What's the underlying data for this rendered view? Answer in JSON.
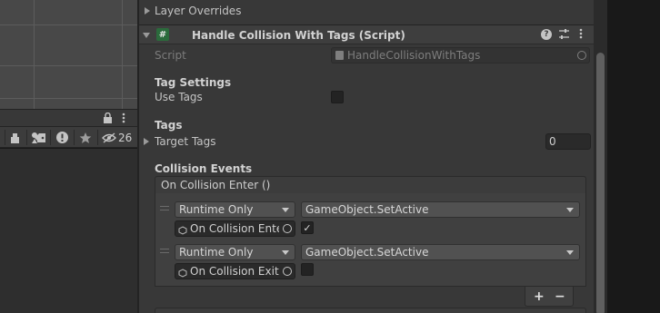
{
  "scene": {},
  "hierarchy_toolbar": {
    "hidden_count": "26",
    "icons": [
      "tools-icon",
      "paint-icon",
      "shapes-icon",
      "tag-icon",
      "warning-icon",
      "star-icon",
      "hidden-eye-icon"
    ],
    "header_icons": [
      "lock-icon",
      "more-menu-icon"
    ]
  },
  "inspector": {
    "layer_overrides_label": "Layer Overrides",
    "component": {
      "title": "Handle Collision With Tags (Script)",
      "enabled": true,
      "script_label": "Script",
      "script_value": "HandleCollisionWithTags",
      "header_icons": [
        "help-icon",
        "presets-icon",
        "more-menu-icon"
      ]
    },
    "tag_settings": {
      "heading": "Tag Settings",
      "use_tags_label": "Use Tags",
      "use_tags_checked": false
    },
    "tags": {
      "heading": "Tags",
      "target_tags_label": "Target Tags",
      "target_tags_count": "0"
    },
    "collision_events": {
      "heading": "Collision Events",
      "event_title": "On Collision Enter ()",
      "entries": [
        {
          "runtime": "Runtime Only",
          "function": "GameObject.SetActive",
          "target": "On Collision Enter",
          "checked": true
        },
        {
          "runtime": "Runtime Only",
          "function": "GameObject.SetActive",
          "target": "On Collision Exit",
          "checked": false
        }
      ],
      "add_label": "+",
      "remove_label": "−"
    }
  }
}
